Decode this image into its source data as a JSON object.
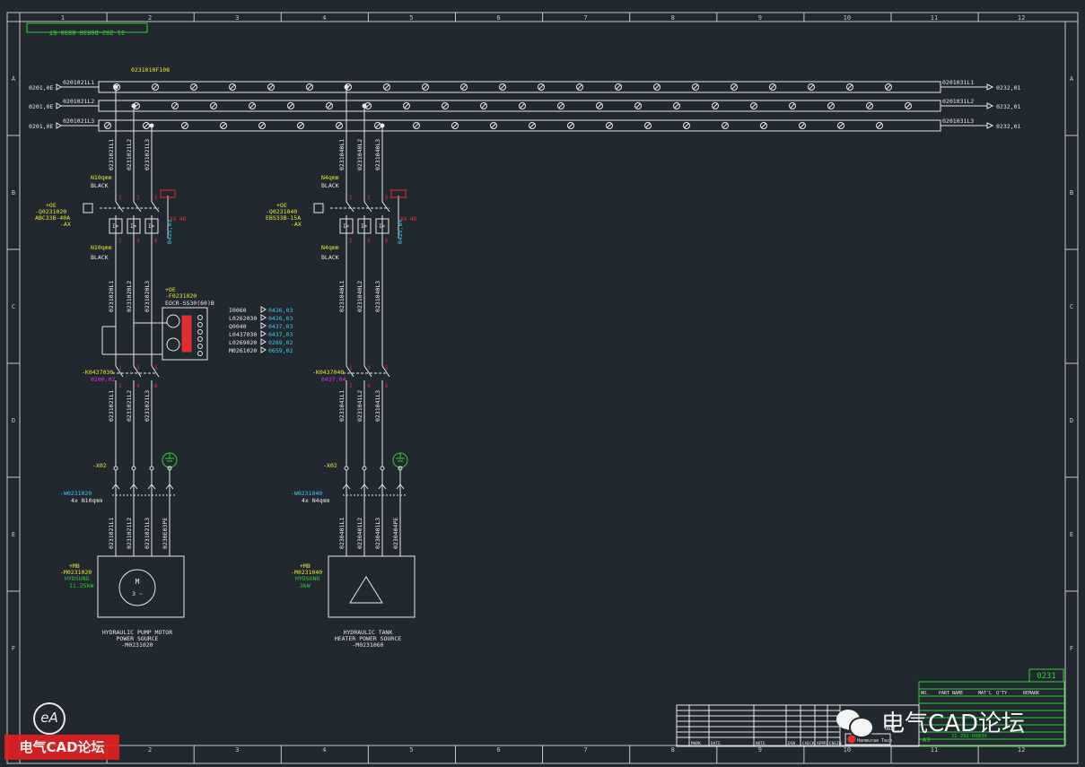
{
  "drawing": {
    "ruler_top": [
      "1",
      "2",
      "3",
      "4",
      "5",
      "6",
      "7",
      "8",
      "9",
      "10",
      "11",
      "12"
    ],
    "ruler_side": [
      "A",
      "B",
      "C",
      "D",
      "E",
      "F"
    ],
    "title_box": "31-Z02-D0830-0830-ET",
    "sheet_no": "0231",
    "colors": {
      "background": "#212830",
      "frame": "#c8c8c8",
      "yellow": "#e8e830",
      "cyan": "#40c8e8",
      "red": "#e03030",
      "green": "#30d030",
      "magenta": "#e030e0",
      "white": "#e8e8e8"
    }
  },
  "busbar": {
    "id_label": "0231010F108",
    "rows": [
      {
        "left_ref": "0201,0E",
        "label": "0201021L1",
        "right_label": "0201031L1",
        "right_ref": "0232,01"
      },
      {
        "left_ref": "0201,0E",
        "label": "0201021L2",
        "right_label": "0201031L2",
        "right_ref": "0232,01"
      },
      {
        "left_ref": "0201,0E",
        "label": "0201021L3",
        "right_label": "0201031L3",
        "right_ref": "0232,01"
      }
    ]
  },
  "circuit1": {
    "top_wires": [
      "0231021L1",
      "0231021L2",
      "0231021L3"
    ],
    "cable_size_top": "N10qmm",
    "cable_color_top": "BLACK",
    "breaker_loc": "+OE",
    "breaker_tag": "-Q0231020",
    "breaker_type": "ABC33B-40A",
    "breaker_aux": "-AX",
    "aux_ref": "0425,03",
    "aux_note": "X4 48",
    "cable_size_bot": "N10qmm",
    "cable_color_bot": "BLACK",
    "mid_wires": [
      "0231020L1",
      "0231020L2",
      "0231020L3"
    ],
    "relay_loc": "+OE",
    "relay_tag": "-F0231020",
    "relay_type": "EOCR-SS30(60)B",
    "relay_contacts": [
      {
        "code": "I0060",
        "ref": "0426,03"
      },
      {
        "code": "L0262030",
        "ref": "0426,03"
      },
      {
        "code": "Q0040",
        "ref": "0437,03"
      },
      {
        "code": "L0437030",
        "ref": "0437,03"
      },
      {
        "code": "L0269020",
        "ref": "0269,02"
      },
      {
        "code": "M0261020",
        "ref": "0659,02"
      }
    ],
    "contactor_tag": "-K0437030",
    "contactor_ref": "0260,02",
    "low_wires": [
      "0231021L1",
      "0231021L2",
      "0231021L3"
    ],
    "terminal": "-X02",
    "cable_tag": "-W0231020",
    "cable_spec": "4x N10qmm",
    "motor_wires": [
      "0231021L1",
      "0231021L2",
      "0231021L3",
      "0230E03PE"
    ],
    "motor_loc": "+MB",
    "motor_tag": "-M0231020",
    "motor_make": "HYDSUNG",
    "motor_power": "11.25kW",
    "caption": [
      "HYDRAULIC PUMP MOTOR",
      "POWER SOURCE",
      "-M0231020"
    ]
  },
  "circuit2": {
    "top_wires": [
      "0231040L1",
      "0231040L2",
      "0231040L3"
    ],
    "cable_size_top": "N4qmm",
    "cable_color_top": "BLACK",
    "breaker_loc": "+OE",
    "breaker_tag": "-Q0231040",
    "breaker_type": "EBS33B-15A",
    "breaker_aux": "-AX",
    "aux_ref": "0425,04",
    "aux_note": "X4 48",
    "cable_size_bot": "N4qmm",
    "cable_color_bot": "BLACK",
    "mid_wires": [
      "0231040L1",
      "0231040L2",
      "0231040L3"
    ],
    "contactor_tag": "-K0437040",
    "contactor_ref": "0437,04",
    "low_wires": [
      "0231041L1",
      "0231041L2",
      "0231041L3"
    ],
    "terminal": "-X02",
    "cable_tag": "-W0231040",
    "cable_spec": "4x N4qmm",
    "motor_wires": [
      "0230401L1",
      "0230401L2",
      "0230401L3",
      "0230404PE"
    ],
    "motor_loc": "+MB",
    "motor_tag": "-M0231040",
    "motor_make": "HYDSUNG",
    "motor_power": "3kW",
    "caption": [
      "HYDRAULIC TANK",
      "HEATER POWER SOURCE",
      "-M0231060"
    ]
  },
  "title_block": {
    "parts_header": [
      "NO.",
      "PART NAME",
      "MAT'L",
      "Q'TY",
      "REMARK"
    ],
    "rev_header": [
      "MARK",
      "DATE",
      "NOTE",
      "DSN",
      "CHECK",
      "APPR.",
      "ENGIN"
    ],
    "company": "Hanmurae Tech",
    "size": "A3",
    "date_label": "DATE",
    "unit_label": "UNIT",
    "dwg_no": "31-Z02-D0830"
  },
  "watermark": {
    "forum": "电气CAD论坛",
    "corner_logo": "eA",
    "corner_text": "电气CAD论坛"
  }
}
